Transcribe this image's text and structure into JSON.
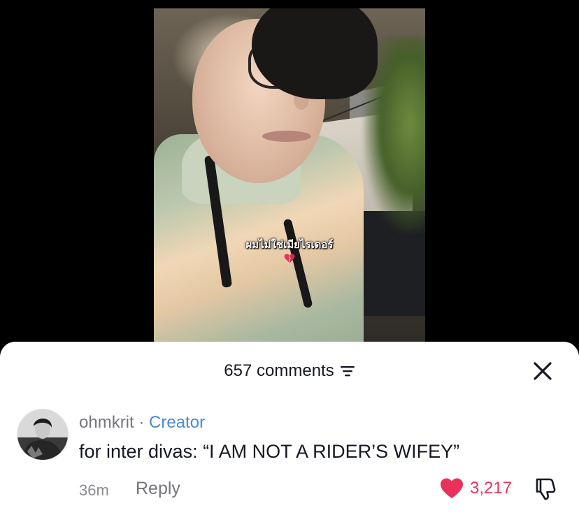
{
  "video": {
    "caption_text": "ผมไม่ใช่เมียไรเดอร์"
  },
  "comments_panel": {
    "count_label": "657 comments"
  },
  "comment": {
    "author": "ohmkrit",
    "separator": "·",
    "badge": "Creator",
    "text": "for inter divas: “I AM NOT A RIDER’S WIFEY”",
    "time": "36m",
    "reply_label": "Reply",
    "like_count": "3,217"
  },
  "colors": {
    "like_red": "#e8325b",
    "creator_blue": "#4b8ad1",
    "text_primary": "#161823",
    "text_secondary": "#75767c"
  },
  "icons": [
    "filter-icon",
    "close-icon",
    "heart-icon",
    "dislike-icon",
    "broken-heart-icon"
  ]
}
